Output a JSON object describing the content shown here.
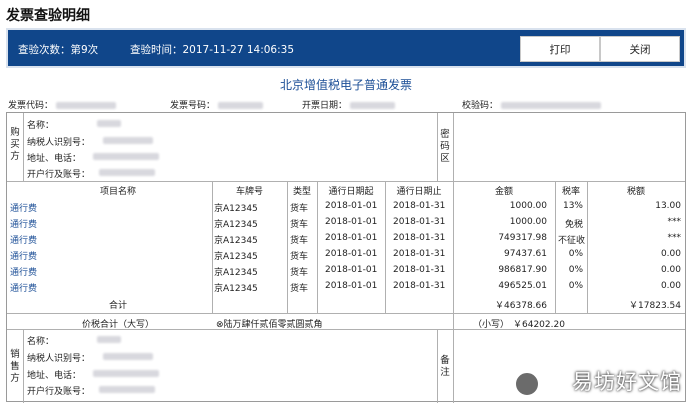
{
  "page_title": "发票查验明细",
  "header": {
    "count_text": "查验次数：第9次",
    "time_text": "查验时间：2017-11-27 14:06:35",
    "print_label": "打印",
    "close_label": "关闭",
    "bar_color": "#10468a"
  },
  "invoice_title": "北京增值税电子普通发票",
  "meta": {
    "code_label": "发票代码：",
    "number_label": "发票号码：",
    "date_label": "开票日期：",
    "check_label": "校验码："
  },
  "buyer": {
    "side_label": "购买方",
    "name_label": "名称：",
    "tax_id_label": "纳税人识别号：",
    "address_label": "地址、电话：",
    "bank_label": "开户行及账号：",
    "password_label": "密码区"
  },
  "items": {
    "headers": [
      "项目名称",
      "车牌号",
      "类型",
      "通行日期起",
      "通行日期止",
      "金额",
      "税率",
      "税额"
    ],
    "rows": [
      [
        "通行费",
        "京A12345",
        "货车",
        "2018-01-01",
        "2018-01-31",
        "1000.00",
        "13%",
        "13.00"
      ],
      [
        "通行费",
        "京A12345",
        "货车",
        "2018-01-01",
        "2018-01-31",
        "1000.00",
        "免税",
        "***"
      ],
      [
        "通行费",
        "京A12345",
        "货车",
        "2018-01-01",
        "2018-01-31",
        "749317.98",
        "不征收",
        "***"
      ],
      [
        "通行费",
        "京A12345",
        "货车",
        "2018-01-01",
        "2018-01-31",
        "97437.61",
        "0%",
        "0.00"
      ],
      [
        "通行费",
        "京A12345",
        "货车",
        "2018-01-01",
        "2018-01-31",
        "986817.90",
        "0%",
        "0.00"
      ],
      [
        "通行费",
        "京A12345",
        "货车",
        "2018-01-01",
        "2018-01-31",
        "496525.01",
        "0%",
        "0.00"
      ]
    ],
    "total_label": "合计",
    "total_amount": "￥46378.66",
    "total_tax": "￥17823.54"
  },
  "grand_total": {
    "label": "价税合计（大写）",
    "uppercase": "⊗陆万肆仟贰佰零贰圆贰角",
    "small_label": "（小写）",
    "small_value": "￥64202.20"
  },
  "seller": {
    "side_label": "销售方",
    "name_label": "名称：",
    "tax_id_label": "纳税人识别号：",
    "address_label": "地址、电话：",
    "bank_label": "开户行及账号：",
    "remark_label": "备注"
  },
  "watermark_text": "易坊好文馆"
}
